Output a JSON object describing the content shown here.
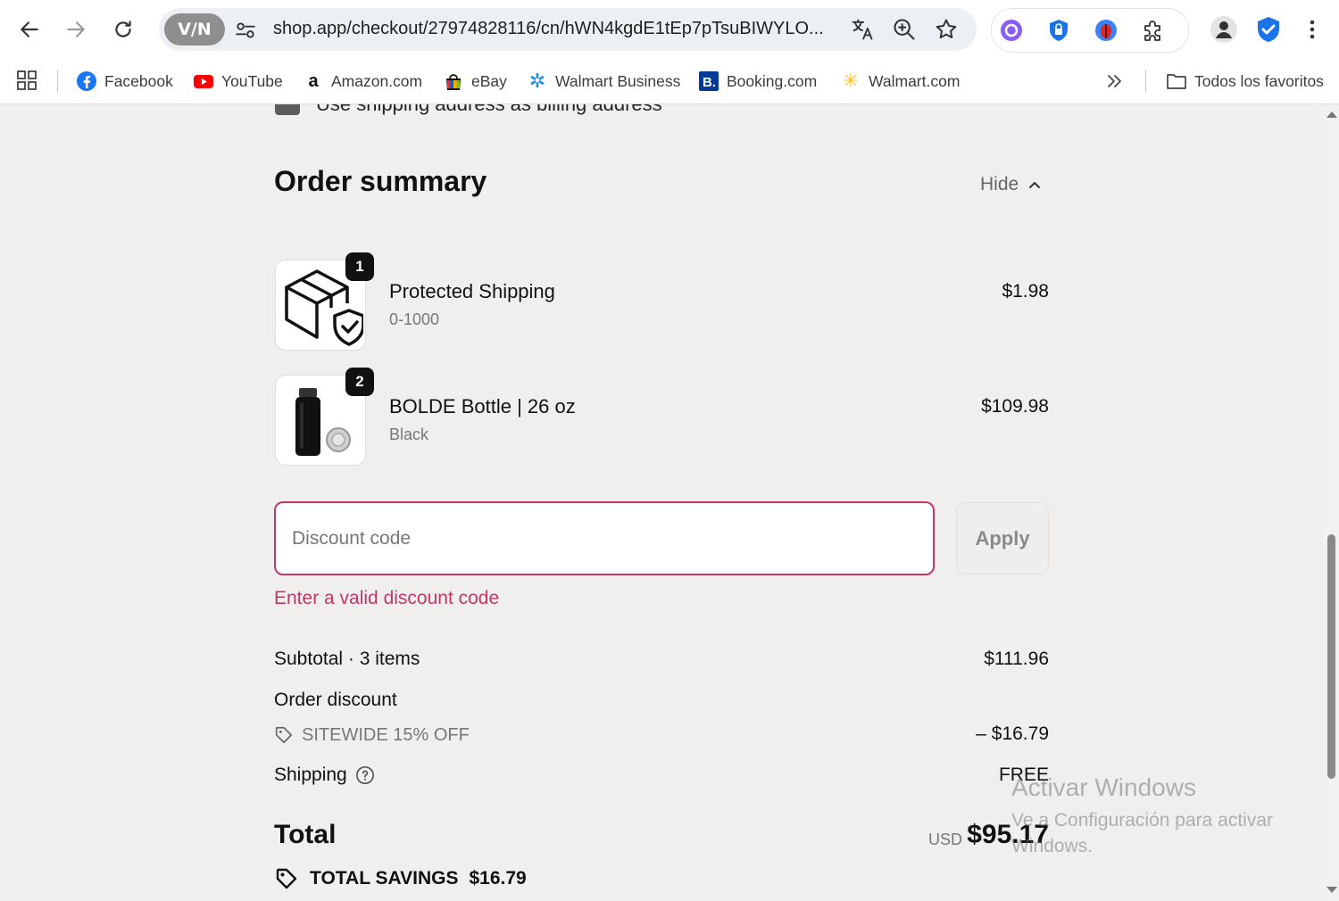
{
  "browser": {
    "vpn_label": "V/N",
    "url": "shop.app/checkout/27974828116/cn/hWN4kgdE1tEp7pTsuBIWYLO..."
  },
  "bookmarks": {
    "items": [
      {
        "label": "Facebook",
        "icon": "facebook-icon"
      },
      {
        "label": "YouTube",
        "icon": "youtube-icon"
      },
      {
        "label": "Amazon.com",
        "icon": "amazon-icon"
      },
      {
        "label": "eBay",
        "icon": "ebay-icon"
      },
      {
        "label": "Walmart Business",
        "icon": "walmart-business-icon"
      },
      {
        "label": "Booking.com",
        "icon": "booking-icon"
      },
      {
        "label": "Walmart.com",
        "icon": "walmart-icon"
      }
    ],
    "all_bookmarks_label": "Todos los favoritos"
  },
  "checkout": {
    "billing_checkbox_label": "Use shipping address as billing address",
    "summary_title": "Order summary",
    "hide_label": "Hide",
    "line_items": [
      {
        "name": "Protected Shipping",
        "variant": "0-1000",
        "price": "$1.98",
        "quantity": "1"
      },
      {
        "name": "BOLDE Bottle | 26 oz",
        "variant": "Black",
        "price": "$109.98",
        "quantity": "2"
      }
    ],
    "discount": {
      "placeholder": "Discount code",
      "apply_label": "Apply",
      "error": "Enter a valid discount code"
    },
    "totals": {
      "subtotal_label": "Subtotal · 3 items",
      "subtotal_value": "$111.96",
      "order_discount_label": "Order discount",
      "discount_code": "SITEWIDE 15% OFF",
      "discount_value": "– $16.79",
      "shipping_label": "Shipping",
      "shipping_value": "FREE",
      "total_label": "Total",
      "currency": "USD",
      "total_value": "$95.17",
      "savings_label": "TOTAL SAVINGS",
      "savings_value": "$16.79"
    }
  },
  "watermark": {
    "title": "Activar Windows",
    "subtitle": "Ve a Configuración para activar Windows."
  },
  "colors": {
    "error": "#c2376a",
    "page_bg": "#f1efee"
  }
}
